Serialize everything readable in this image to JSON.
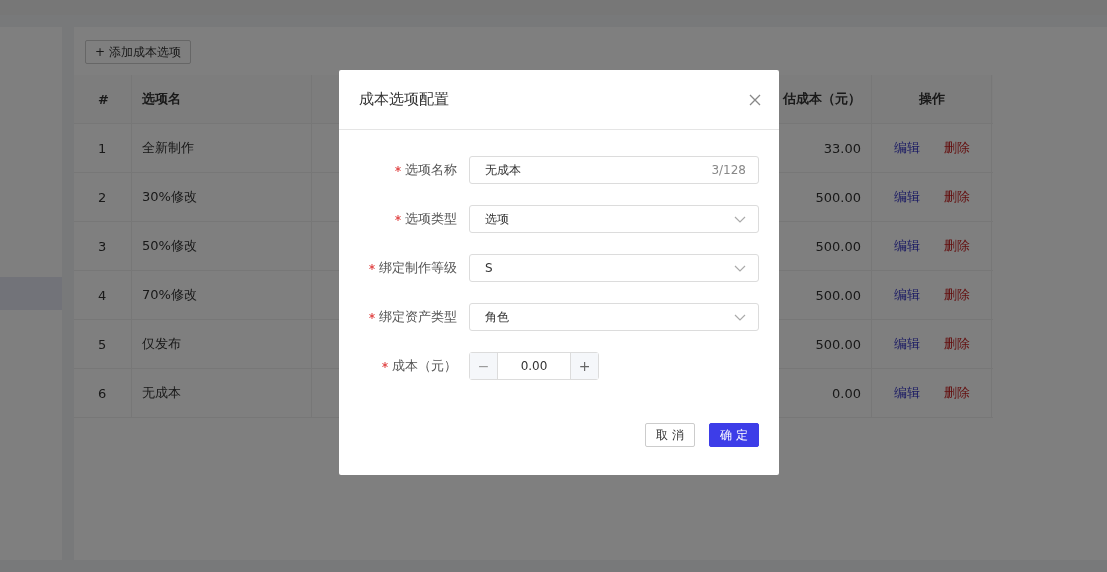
{
  "toolbar": {
    "add_button": "+ 添加成本选项"
  },
  "table": {
    "columns": [
      "#",
      "选项名",
      "估成本（元）",
      "操作"
    ],
    "rows": [
      {
        "index": "1",
        "name": "全新制作",
        "cost": "33.00",
        "edit": "编辑",
        "delete": "删除"
      },
      {
        "index": "2",
        "name": "30%修改",
        "cost": "500.00",
        "edit": "编辑",
        "delete": "删除"
      },
      {
        "index": "3",
        "name": "50%修改",
        "cost": "500.00",
        "edit": "编辑",
        "delete": "删除"
      },
      {
        "index": "4",
        "name": "70%修改",
        "cost": "500.00",
        "edit": "编辑",
        "delete": "删除"
      },
      {
        "index": "5",
        "name": "仅发布",
        "cost": "500.00",
        "edit": "编辑",
        "delete": "删除"
      },
      {
        "index": "6",
        "name": "无成本",
        "cost": "0.00",
        "edit": "编辑",
        "delete": "删除"
      }
    ]
  },
  "dialog": {
    "title": "成本选项配置",
    "fields": [
      {
        "kind": "text",
        "label": "选项名称",
        "required": true,
        "value": "无成本",
        "counter": "3/128"
      },
      {
        "kind": "select",
        "label": "选项类型",
        "required": true,
        "value": "选项"
      },
      {
        "kind": "select",
        "label": "绑定制作等级",
        "required": true,
        "value": "S"
      },
      {
        "kind": "select",
        "label": "绑定资产类型",
        "required": true,
        "value": "角色"
      },
      {
        "kind": "number",
        "label": "成本（元）",
        "required": true,
        "value": "0.00",
        "minus": "−",
        "plus": "+"
      }
    ],
    "buttons": [
      {
        "kind": "cancel",
        "label": "取 消"
      },
      {
        "kind": "primary",
        "label": "确 定"
      }
    ]
  }
}
